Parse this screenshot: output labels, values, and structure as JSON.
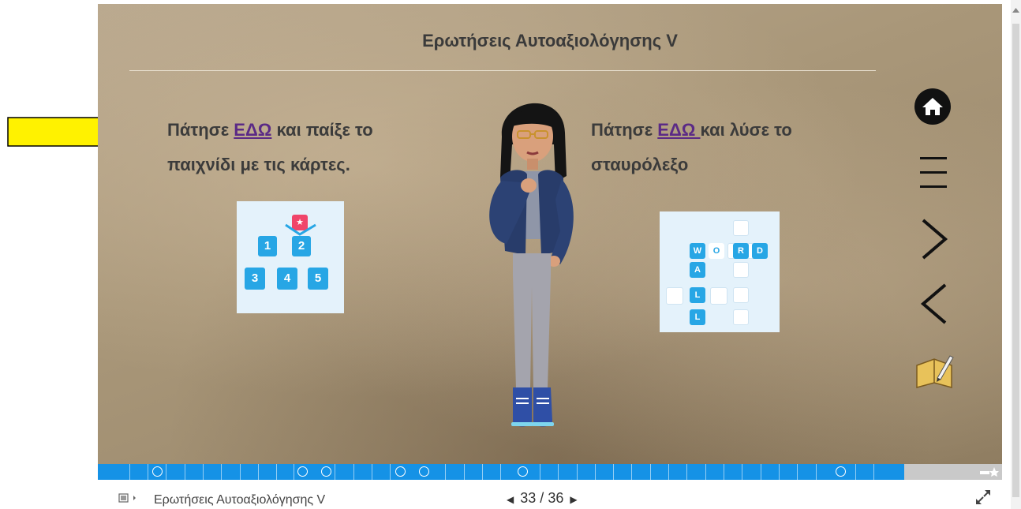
{
  "slide": {
    "title": "Ερωτήσεις Αυτοαξιολόγησης V",
    "left_prefix": "Πάτησε ",
    "left_link": "ΕΔΩ",
    "left_suffix": " και παίξε το",
    "left_line2": "παιχνίδι με τις κάρτες.",
    "right_prefix": "Πάτησε ",
    "right_link": "ΕΔΩ ",
    "right_suffix": "και λύσε το",
    "right_line2": "σταυρόλεξο"
  },
  "cards_game": {
    "tiles": [
      "1",
      "2",
      "3",
      "4",
      "5"
    ],
    "star": "★"
  },
  "crossword": {
    "row": [
      "W",
      "O",
      "R",
      "D"
    ],
    "col": [
      "A",
      "L",
      "L"
    ]
  },
  "nav": {
    "icons": [
      "home-icon",
      "menu-icon",
      "next-arrow-icon",
      "prev-arrow-icon",
      "notebook-icon"
    ]
  },
  "footer": {
    "title": "Ερωτήσεις Αυτοαξιολόγησης V",
    "current_page": "33",
    "separator": "/",
    "total_pages": "36",
    "prev": "◀",
    "next": "▶"
  },
  "colors": {
    "progress": "#1592e6",
    "tile": "#27a6e5",
    "link": "#5b2a86",
    "arrow": "#fff200"
  }
}
